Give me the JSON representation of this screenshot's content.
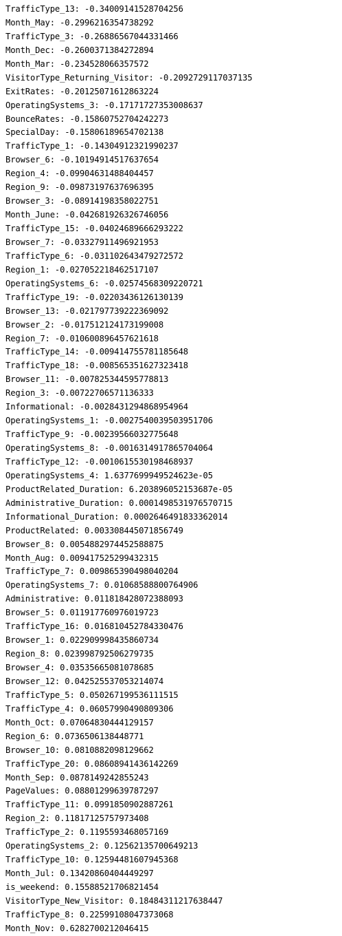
{
  "lines": [
    "TrafficType_13: -0.34009141528704256",
    "Month_May: -0.2996216354738292",
    "TrafficType_3: -0.26886567044331466",
    "Month_Dec: -0.260037138427289‍4",
    "Month_Mar: -0.234528066357572",
    "VisitorType_Returning_Visitor: -0.2092729117037135",
    "ExitRates: -0.20125071612863224",
    "OperatingSystems_3: -0.17171727353008637",
    "BounceRates: -0.15860752704242273",
    "SpecialDay: -0.15806189654702138",
    "TrafficType_1: -0.14304912321990237",
    "Browser_6: -0.10194914517637654",
    "Region_4: -0.09904631488404457",
    "Region_9: -0.09873197637696395",
    "Browser_3: -0.08914198358022751",
    "Month_June: -0.042681926326746056",
    "TrafficType_15: -0.04024689666293222",
    "Browser_7: -0.03327911496921953",
    "TrafficType_6: -0.031102643479272572",
    "Region_1: -0.027052218462517107",
    "OperatingSystems_6: -0.02574568309220721",
    "TrafficType_19: -0.02203436126130139",
    "Browser_13: -0.021797739222369092",
    "Browser_2: -0.017512124173199008",
    "Region_7: -0.010600896457621618",
    "TrafficType_14: -0.009414755781185648",
    "TrafficType_18: -0.008565351627323418",
    "Browser_11: -0.007825344595778813",
    "Region_3: -0.00722706571136333",
    "Informational: -0.0028431294868954964",
    "OperatingSystems_1: -0.0027540039503951706",
    "TrafficType_9: -0.00239566032775648",
    "OperatingSystems_8: -0.0016314917865704064",
    "TrafficType_12: -0.0010615530198468937",
    "OperatingSystems_4: 1.6377699949524623e-05",
    "ProductRelated_Duration: 6.203896052153687e-05",
    "Administrative_Duration: 0.0001498531976570715",
    "Informational_Duration: 0.0002646491833362014",
    "ProductRelated: 0.003308445071856749",
    "Browser_8: 0.0054882974452588875",
    "Month_Aug: 0.009417525299432315",
    "TrafficType_7: 0.009865390498040204",
    "OperatingSystems_7: 0.01068588800764906",
    "Administrative: 0.011818428072388093",
    "Browser_5: 0.011917760976019723",
    "TrafficType_16: 0.016810452784330476",
    "Browser_1: 0.022909998435860734",
    "Region_8: 0.023998792506279735",
    "Browser_4: 0.03535665081078685",
    "Browser_12: 0.042525537053214074",
    "TrafficType_5: 0.050267199536111515",
    "TrafficType_4: 0.06057990490809306",
    "Month_Oct: 0.07064830444129157",
    "Region_6: 0.0736506138448771",
    "Browser_10: 0.0810882098129662",
    "TrafficType_20: 0.08608941436142269",
    "Month_Sep: 0.0878149242855243",
    "PageValues: 0.08801299639787297",
    "TrafficType_11: 0.0991850902887261",
    "Region_2: 0.11817125757973408",
    "TrafficType_2: 0.1195593468057169",
    "OperatingSystems_2: 0.12562135700649213",
    "TrafficType_10: 0.12594481607945368",
    "Month_Jul: 0.13420860404449297",
    "is_weekend: 0.15588521706821454",
    "VisitorType_New_Visitor: 0.18484311217638447",
    "TrafficType_8: 0.22599108047373068",
    "Month_Nov: 0.6282700212046415"
  ]
}
